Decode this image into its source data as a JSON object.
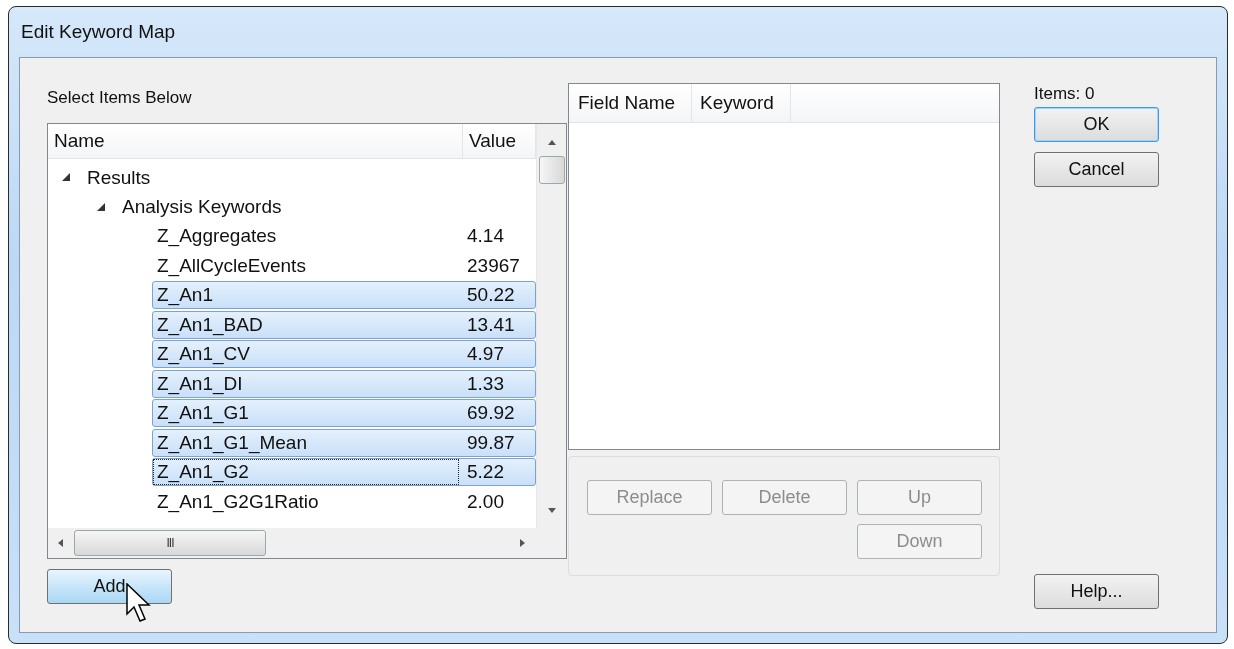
{
  "window": {
    "title": "Edit Keyword Map"
  },
  "tree": {
    "label": "Select Items Below",
    "columns": [
      "Name",
      "Value"
    ],
    "items": [
      {
        "name": "Results",
        "expanded": true,
        "children": [
          {
            "name": "Analysis Keywords",
            "expanded": true,
            "children": [
              {
                "name": "Z_Aggregates",
                "value": "4.14",
                "selected": false,
                "focused": false
              },
              {
                "name": "Z_AllCycleEvents",
                "value": "23967",
                "selected": false,
                "focused": false
              },
              {
                "name": "Z_An1",
                "value": "50.22",
                "selected": true,
                "focused": false
              },
              {
                "name": "Z_An1_BAD",
                "value": "13.41",
                "selected": true,
                "focused": false
              },
              {
                "name": "Z_An1_CV",
                "value": "4.97",
                "selected": true,
                "focused": false
              },
              {
                "name": "Z_An1_DI",
                "value": "1.33",
                "selected": true,
                "focused": false
              },
              {
                "name": "Z_An1_G1",
                "value": "69.92",
                "selected": true,
                "focused": false
              },
              {
                "name": "Z_An1_G1_Mean",
                "value": "99.87",
                "selected": true,
                "focused": false
              },
              {
                "name": "Z_An1_G2",
                "value": "5.22",
                "selected": true,
                "focused": true
              },
              {
                "name": "Z_An1_G2G1Ratio",
                "value": "2.00",
                "selected": false,
                "focused": false
              }
            ]
          }
        ]
      }
    ]
  },
  "scrollbar_h_grip": "III",
  "add_button": {
    "label": "Add"
  },
  "map_list": {
    "columns": [
      "Field Name",
      "Keyword"
    ]
  },
  "list_buttons": [
    {
      "label": "Replace",
      "disabled": true
    },
    {
      "label": "Delete",
      "disabled": true
    },
    {
      "label": "Up",
      "disabled": true
    },
    {
      "label": "Down",
      "disabled": true
    }
  ],
  "items_count": "Items: 0",
  "buttons": [
    {
      "label": "OK",
      "default": true
    },
    {
      "label": "Cancel",
      "default": false
    }
  ],
  "help_button": {
    "label": "Help..."
  }
}
